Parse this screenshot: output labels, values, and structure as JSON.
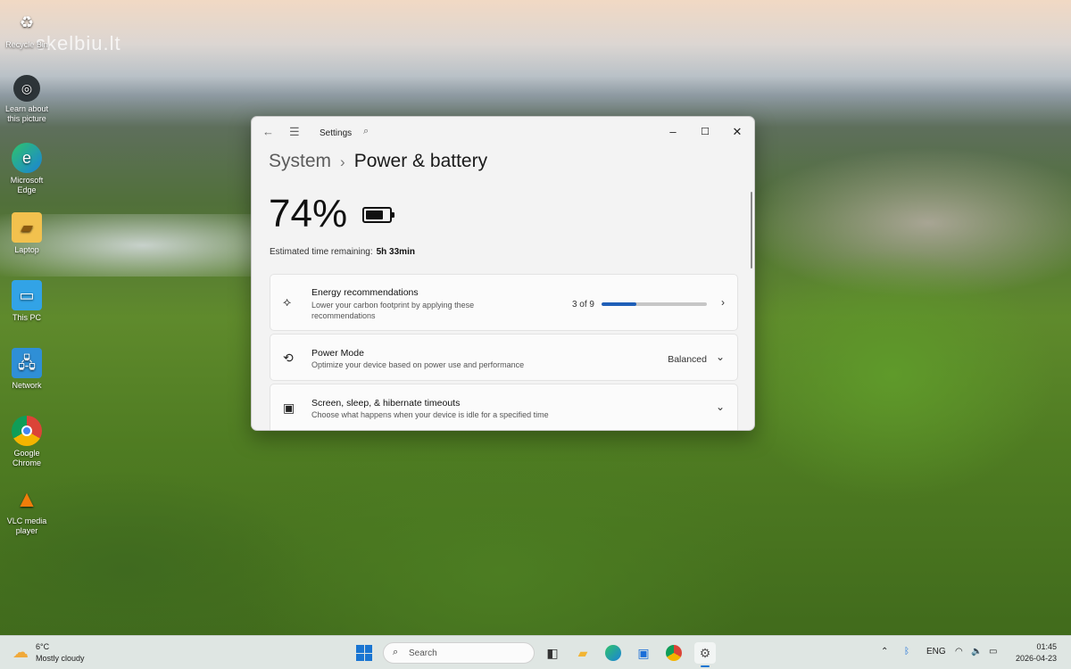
{
  "watermark": "skelbiu.lt",
  "desktop_icons": [
    {
      "label": "Recycle Bin",
      "icon": "recycle-bin-icon"
    },
    {
      "label": "Learn about this picture",
      "icon": "camera-icon"
    },
    {
      "label": "Microsoft Edge",
      "icon": "edge-icon"
    },
    {
      "label": "Laptop",
      "icon": "folder-icon"
    },
    {
      "label": "This PC",
      "icon": "monitor-icon"
    },
    {
      "label": "Network",
      "icon": "network-icon"
    },
    {
      "label": "Google Chrome",
      "icon": "chrome-icon"
    },
    {
      "label": "VLC media player",
      "icon": "vlc-icon"
    }
  ],
  "window": {
    "app_title": "Settings",
    "breadcrumb_parent": "System",
    "breadcrumb_separator": "›",
    "page_title": "Power & battery",
    "battery_percent": "74%",
    "battery_level": 0.74,
    "time_remaining_label": "Estimated time remaining:",
    "time_remaining_value": "5h 33min",
    "cards": {
      "energy": {
        "title": "Energy recommendations",
        "description": "Lower your carbon footprint by applying these recommendations",
        "progress_text": "3 of 9",
        "progress": 0.333
      },
      "power_mode": {
        "title": "Power Mode",
        "description": "Optimize your device based on power use and performance",
        "value": "Balanced"
      },
      "timeouts": {
        "title": "Screen, sleep, & hibernate timeouts",
        "description": "Choose what happens when your device is idle for a specified time"
      }
    }
  },
  "taskbar": {
    "weather_temp": "6°C",
    "weather_condition": "Mostly cloudy",
    "search_placeholder": "Search",
    "language": "ENG",
    "time": "01:45",
    "date": "2026-04-23",
    "accent_color": "#1a75d2"
  }
}
